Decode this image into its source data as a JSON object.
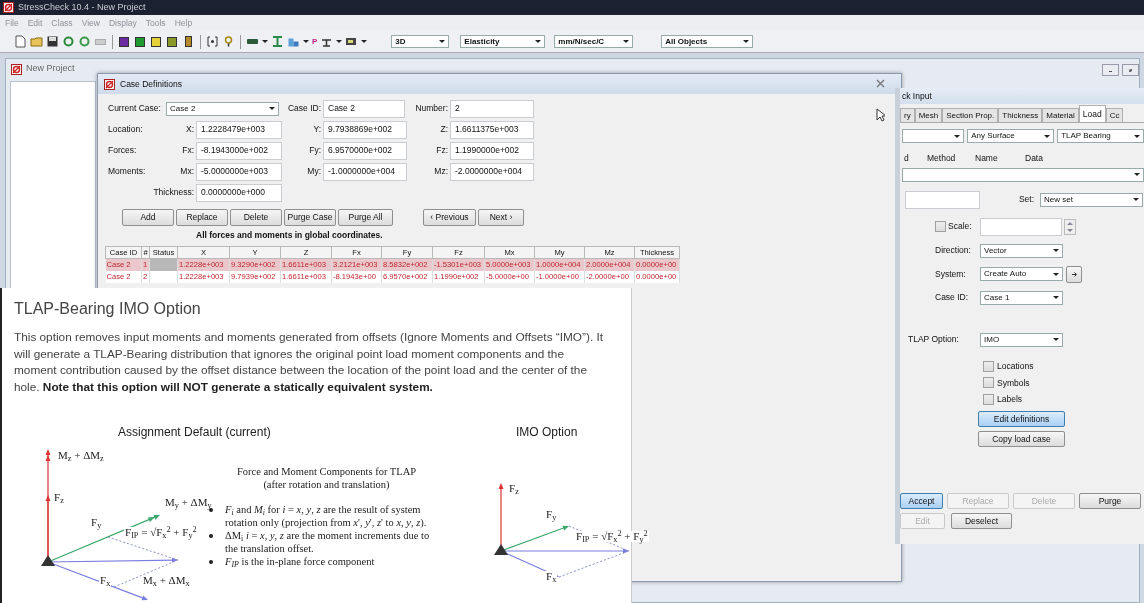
{
  "app": {
    "title": "StressCheck 10.4 - New Project"
  },
  "menu": [
    "File",
    "Edit",
    "Class",
    "View",
    "Display",
    "Tools",
    "Help"
  ],
  "toolbar": {
    "glyph": "P",
    "dropdowns": [
      "3D",
      "Elasticity",
      "mm/N/sec/C",
      "All Objects"
    ]
  },
  "project_window": {
    "title": "New Project"
  },
  "case_dialog": {
    "title": "Case Definitions",
    "current_case": {
      "label": "Current Case:",
      "value": "Case 2"
    },
    "case_id": {
      "label": "Case ID:",
      "value": "Case 2"
    },
    "number": {
      "label": "Number:",
      "value": "2"
    },
    "vector_rows": [
      {
        "label": "Location:",
        "fields": [
          {
            "axis": "X:",
            "value": "1.2228479e+003"
          },
          {
            "axis": "Y:",
            "value": "9.7938869e+002"
          },
          {
            "axis": "Z:",
            "value": "1.6611375e+003"
          }
        ]
      },
      {
        "label": "Forces:",
        "fields": [
          {
            "axis": "Fx:",
            "value": "-8.1943000e+002"
          },
          {
            "axis": "Fy:",
            "value": "6.9570000e+002"
          },
          {
            "axis": "Fz:",
            "value": "1.1990000e+002"
          }
        ]
      },
      {
        "label": "Moments:",
        "fields": [
          {
            "axis": "Mx:",
            "value": "-5.0000000e+003"
          },
          {
            "axis": "My:",
            "value": "-1.0000000e+004"
          },
          {
            "axis": "Mz:",
            "value": "-2.0000000e+004"
          }
        ]
      }
    ],
    "thickness": {
      "label": "Thickness:",
      "value": "0.0000000e+000"
    },
    "buttons": [
      "Add",
      "Replace",
      "Delete",
      "Purge Case",
      "Purge All"
    ],
    "nav_buttons": [
      "‹ Previous",
      "Next ›"
    ],
    "note": "All forces and moments in global coordinates.",
    "table": {
      "columns": [
        "Case ID",
        "#",
        "Status",
        "X",
        "Y",
        "Z",
        "Fx",
        "Fy",
        "Fz",
        "Mx",
        "My",
        "Mz",
        "Thickness"
      ],
      "rows": [
        {
          "selected": true,
          "cells": [
            "Case 2",
            "1",
            "",
            "1.2228e+003",
            "9.3290e+002",
            "1.6611e+003",
            "3.2121e+003",
            "8.5832e+002",
            "-1.5301e+003",
            "5.0000e+003",
            "1.0000e+004",
            "2.0000e+004",
            "0.0000e+00"
          ]
        },
        {
          "selected": false,
          "cells": [
            "Case 2",
            "2",
            "",
            "1.2228e+003",
            "9.7939e+002",
            "1.6611e+003",
            "-8.1943e+00",
            "6.9570e+002",
            "1.1990e+002",
            "-5.0000e+00",
            "-1.0000e+00",
            "-2.0000e+00",
            "0.0000e+00"
          ]
        }
      ]
    }
  },
  "right_panel": {
    "title": "ck Input",
    "tabs": [
      {
        "label": "ry",
        "selected": false
      },
      {
        "label": "Mesh",
        "selected": false
      },
      {
        "label": "Section Prop.",
        "selected": false
      },
      {
        "label": "Thickness",
        "selected": false
      },
      {
        "label": "Material",
        "selected": false
      },
      {
        "label": "Load",
        "selected": true
      },
      {
        "label": "Cc",
        "selected": false
      }
    ],
    "selectors": [
      "Any Surface",
      "TLAP Bearing"
    ],
    "columns": [
      "d",
      "Method",
      "Name",
      "Data"
    ],
    "set": {
      "label": "Set:",
      "value": "New set"
    },
    "scale": {
      "label": "Scale:",
      "checked": false
    },
    "fields": [
      {
        "label": "Direction:",
        "value": "Vector"
      },
      {
        "label": "System:",
        "value": "Create Auto"
      },
      {
        "label": "Case ID:",
        "value": "Case 1"
      }
    ],
    "tlap_option": {
      "label": "TLAP Option:",
      "value": "IMO"
    },
    "checkboxes": [
      {
        "label": "Locations",
        "checked": false
      },
      {
        "label": "Symbols",
        "checked": false
      },
      {
        "label": "Labels",
        "checked": false
      }
    ],
    "buttons": [
      {
        "label": "Edit definitions",
        "focused": true
      },
      {
        "label": "Copy load case",
        "focused": false
      }
    ],
    "actions": [
      {
        "label": "Accept",
        "disabled": false,
        "focused": true
      },
      {
        "label": "Replace",
        "disabled": true,
        "focused": false
      },
      {
        "label": "Delete",
        "disabled": true,
        "focused": false
      },
      {
        "label": "Purge",
        "disabled": false,
        "focused": false
      },
      {
        "label": "Edit",
        "disabled": true,
        "focused": false
      },
      {
        "label": "Deselect",
        "disabled": false,
        "focused": false
      }
    ]
  },
  "slide": {
    "title": "TLAP-Bearing IMO Option",
    "paragraph": "This option removes input moments and moments generated from offsets (Ignore Moments and Offsets “IMO”). It will generate a TLAP-Bearing distribution that ignores the original point load moment components and the moment contribution caused by the offset distance between the location of the point load and the center of the hole. **Note that this option will NOT generate a statically equivalent system.**",
    "panels": [
      {
        "heading": "Assignment Default (current)",
        "labels": [
          "M$_{z}$ + ΔM$_{z}$",
          "F$_{z}$",
          "F$_{y}$",
          "M$_{y}$ + ΔM$_{y}$",
          "F$_{IP}$ = √F$_{x}$$^{2}$ + F$_{y}$$^{2}$",
          "F$_{x}$",
          "M$_{x}$ + ΔM$_{x}$"
        ]
      },
      {
        "heading": "IMO Option",
        "labels": [
          "F$_{z}$",
          "F$_{y}$",
          "F$_{IP}$ = √F$_{x}$$^{2}$ + F$_{y}$$^{2}$",
          "F$_{x}$"
        ]
      }
    ],
    "components": {
      "title": "Force and Moment Components for TLAP",
      "subtitle": "(after rotation and translation)",
      "bullets": [
        "*F$_{i}$* and *M$_{i}$* for *i* = *x*, *y*, *z* are the result of system rotation only (projection from *x*', *y*', *z*' to *x*, *y*, *z*).",
        "ΔM$_{i}$ *i* = *x*, *y*, *z* are the moment increments due to the translation offset.",
        "*F$_{IP}$* is the in-plane force component"
      ]
    }
  }
}
